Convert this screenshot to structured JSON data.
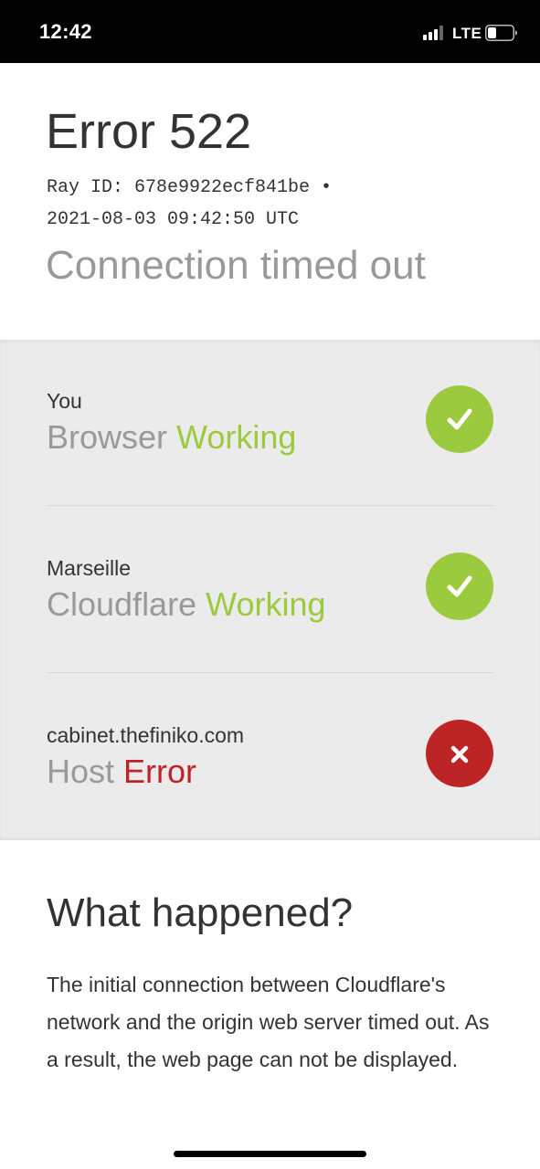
{
  "status_bar": {
    "time": "12:42",
    "network": "LTE",
    "signal_icon": "signal-bars-icon",
    "battery_icon": "battery-icon"
  },
  "header": {
    "title": "Error 522",
    "ray_line_1": "Ray ID: 678e9922ecf841be •",
    "ray_line_2": "2021-08-03 09:42:50 UTC",
    "subtitle": "Connection timed out"
  },
  "status_rows": [
    {
      "location": "You",
      "kind": "Browser",
      "state": "Working",
      "icon": "check-icon",
      "color": "#9bca3e"
    },
    {
      "location": "Marseille",
      "kind": "Cloudflare",
      "state": "Working",
      "icon": "check-icon",
      "color": "#9bca3e"
    },
    {
      "location": "cabinet.thefiniko.com",
      "kind": "Host",
      "state": "Error",
      "icon": "x-icon",
      "color": "#bd2426"
    }
  ],
  "what_happened": {
    "title": "What happened?",
    "body": "The initial connection between Cloudflare's network and the origin web server timed out. As a result, the web page can not be displayed."
  },
  "colors": {
    "working": "#9bca3e",
    "error": "#bd2426",
    "status_section_bg": "#ebebeb"
  }
}
